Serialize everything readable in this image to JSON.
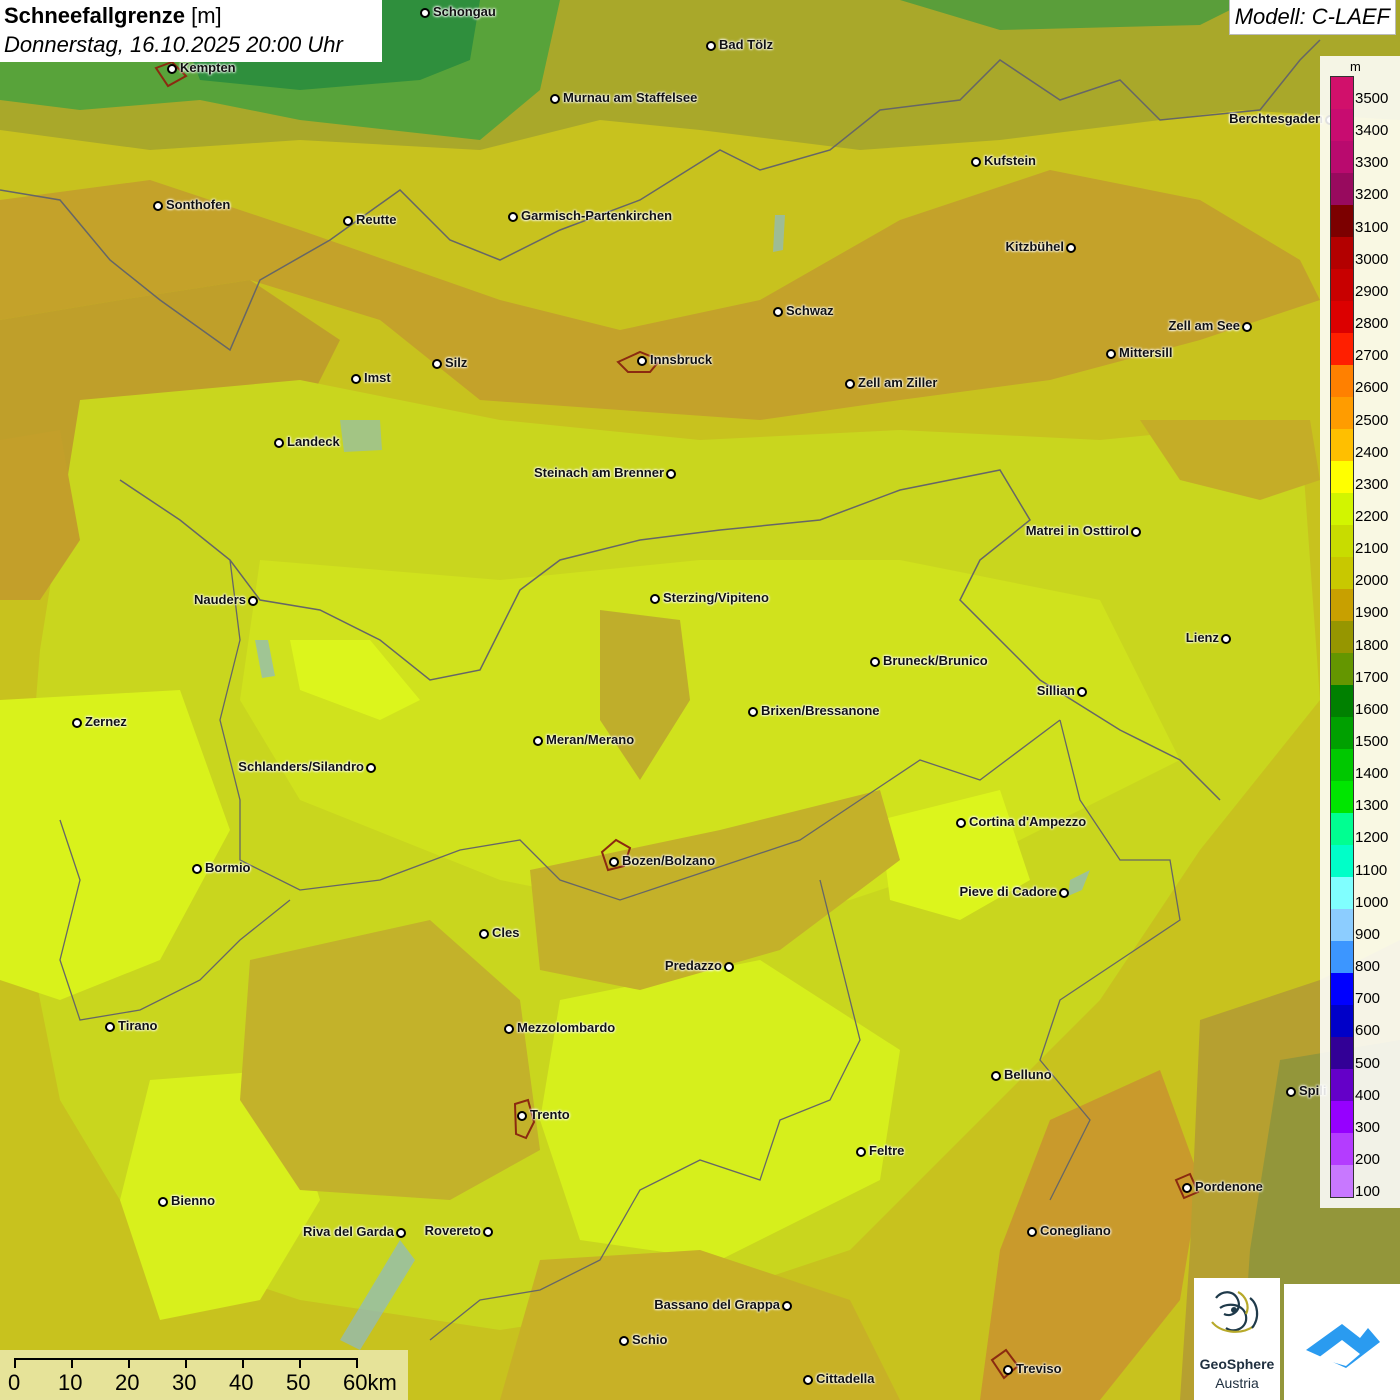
{
  "header": {
    "title_main": "Schneefallgrenze",
    "title_unit": "[m]",
    "subtitle": "Donnerstag, 16.10.2025 20:00 Uhr",
    "model": "Modell: C-LAEF"
  },
  "legend": {
    "unit": "m",
    "labels": [
      "3500",
      "3400",
      "3300",
      "3200",
      "3100",
      "3000",
      "2900",
      "2800",
      "2700",
      "2600",
      "2500",
      "2400",
      "2300",
      "2200",
      "2100",
      "2000",
      "1900",
      "1800",
      "1700",
      "1600",
      "1500",
      "1400",
      "1300",
      "1200",
      "1100",
      "1000",
      "900",
      "800",
      "700",
      "600",
      "500",
      "400",
      "300",
      "200",
      "100"
    ],
    "colors": [
      "#d1106b",
      "#c80c70",
      "#b90a6e",
      "#980a5e",
      "#7c0000",
      "#b30000",
      "#c80000",
      "#dc0000",
      "#ff1f00",
      "#ff8000",
      "#ff9c00",
      "#ffbf00",
      "#ffff00",
      "#d2f500",
      "#c8dc00",
      "#c8c800",
      "#c8a000",
      "#969600",
      "#649600",
      "#008000",
      "#00a000",
      "#00c800",
      "#00e600",
      "#00ff91",
      "#00ffc8",
      "#80ffff",
      "#8ccdff",
      "#3c96ff",
      "#0000ff",
      "#0000c8",
      "#320096",
      "#6400c8",
      "#9600ff",
      "#b43cff",
      "#c878ff"
    ]
  },
  "places": [
    {
      "name": "Schongau",
      "pos": "right"
    },
    {
      "name": "Kempten",
      "pos": "right"
    },
    {
      "name": "Bad Tölz",
      "pos": "right"
    },
    {
      "name": "Murnau am Staffelsee",
      "pos": "right"
    },
    {
      "name": "Berchtesgaden",
      "pos": "left"
    },
    {
      "name": "Kufstein",
      "pos": "right"
    },
    {
      "name": "Sonthofen",
      "pos": "right"
    },
    {
      "name": "Reutte",
      "pos": "right"
    },
    {
      "name": "Garmisch-Partenkirchen",
      "pos": "right"
    },
    {
      "name": "Kitzbühel",
      "pos": "left"
    },
    {
      "name": "Schwaz",
      "pos": "right"
    },
    {
      "name": "Zell am See",
      "pos": "left"
    },
    {
      "name": "Innsbruck",
      "pos": "right"
    },
    {
      "name": "Mittersill",
      "pos": "right"
    },
    {
      "name": "Imst",
      "pos": "right"
    },
    {
      "name": "Silz",
      "pos": "right"
    },
    {
      "name": "Zell am Ziller",
      "pos": "right"
    },
    {
      "name": "Landeck",
      "pos": "right"
    },
    {
      "name": "Steinach am Brenner",
      "pos": "left"
    },
    {
      "name": "Matrei in Osttirol",
      "pos": "left"
    },
    {
      "name": "Nauders",
      "pos": "left"
    },
    {
      "name": "Sterzing/Vipiteno",
      "pos": "right"
    },
    {
      "name": "Lienz",
      "pos": "left"
    },
    {
      "name": "Bruneck/Brunico",
      "pos": "right"
    },
    {
      "name": "Sillian",
      "pos": "left"
    },
    {
      "name": "Brixen/Bressanone",
      "pos": "right"
    },
    {
      "name": "Zernez",
      "pos": "right"
    },
    {
      "name": "Meran/Merano",
      "pos": "right"
    },
    {
      "name": "Schlanders/Silandro",
      "pos": "left"
    },
    {
      "name": "Cortina d'Ampezzo",
      "pos": "right"
    },
    {
      "name": "Bozen/Bolzano",
      "pos": "right"
    },
    {
      "name": "Bormio",
      "pos": "right"
    },
    {
      "name": "Pieve di Cadore",
      "pos": "left"
    },
    {
      "name": "Cles",
      "pos": "right"
    },
    {
      "name": "Predazzo",
      "pos": "left"
    },
    {
      "name": "Tirano",
      "pos": "right"
    },
    {
      "name": "Mezzolombardo",
      "pos": "right"
    },
    {
      "name": "Belluno",
      "pos": "right"
    },
    {
      "name": "Spili",
      "pos": "right"
    },
    {
      "name": "Trento",
      "pos": "right"
    },
    {
      "name": "Feltre",
      "pos": "right"
    },
    {
      "name": "Pordenone",
      "pos": "right"
    },
    {
      "name": "Bienno",
      "pos": "right"
    },
    {
      "name": "Riva del Garda",
      "pos": "left"
    },
    {
      "name": "Rovereto",
      "pos": "left"
    },
    {
      "name": "Conegliano",
      "pos": "right"
    },
    {
      "name": "Bassano del Grappa",
      "pos": "left"
    },
    {
      "name": "Schio",
      "pos": "right"
    },
    {
      "name": "Treviso",
      "pos": "right"
    },
    {
      "name": "Cittadella",
      "pos": "right"
    }
  ],
  "scale": {
    "labels": [
      "0",
      "10",
      "20",
      "30",
      "40",
      "50",
      "60km"
    ]
  },
  "logos": {
    "geosphere_line1": "GeoSphere",
    "geosphere_line2": "Austria"
  }
}
